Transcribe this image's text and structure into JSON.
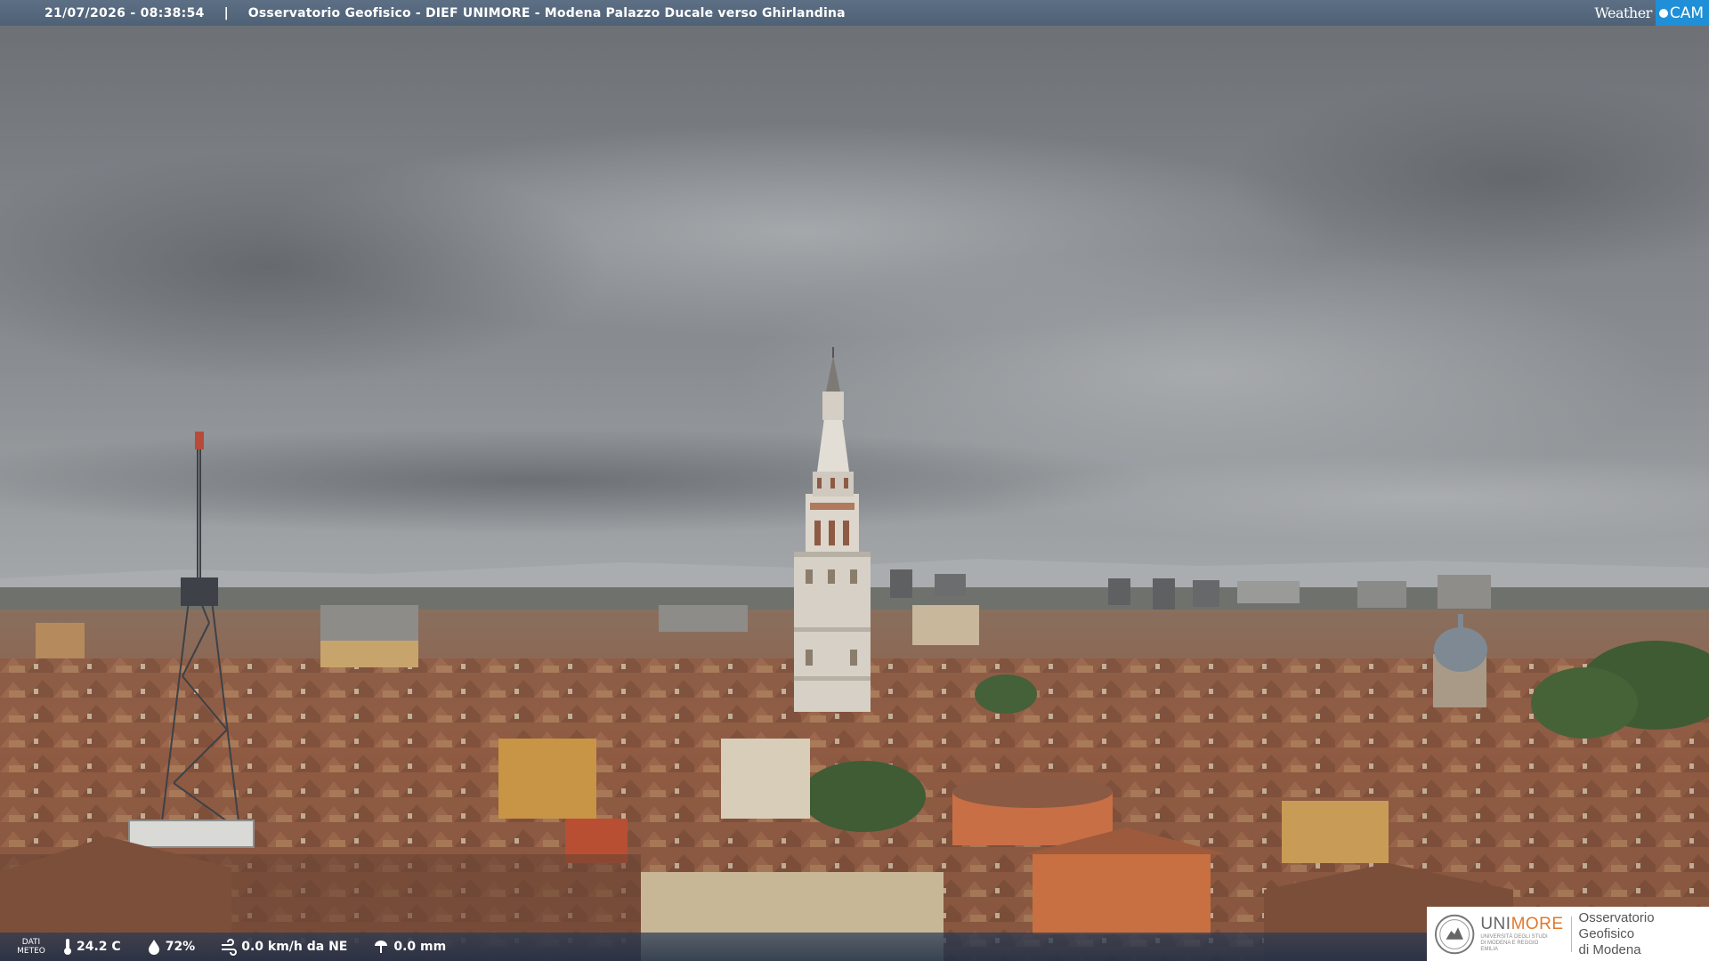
{
  "header": {
    "datetime": "21/07/2026 - 08:38:54",
    "separator": "|",
    "title": "Osservatorio Geofisico - DIEF UNIMORE - Modena Palazzo Ducale verso Ghirlandina",
    "logo_weather": "Weather",
    "logo_cam": "CAM"
  },
  "weather_bar": {
    "label_line1": "DATI",
    "label_line2": "METEO",
    "temperature": "24.2 C",
    "humidity": "72%",
    "wind": "0.0 km/h da NE",
    "rain": "0.0 mm",
    "icons": [
      "thermometer-icon",
      "humidity-drop-icon",
      "wind-icon",
      "rain-gauge-icon"
    ]
  },
  "branding": {
    "uni_prefix": "UNI",
    "uni_suffix": "MORE",
    "uni_subtitle": "UNIVERSITÀ DEGLI STUDI DI MODENA E REGGIO EMILIA",
    "observatory_line1": "Osservatorio Geofisico",
    "observatory_line2": "di Modena"
  },
  "colors": {
    "header_bg": "#56687d",
    "cam_accent": "#1f8fd8",
    "unimore_orange": "#e0782b"
  }
}
